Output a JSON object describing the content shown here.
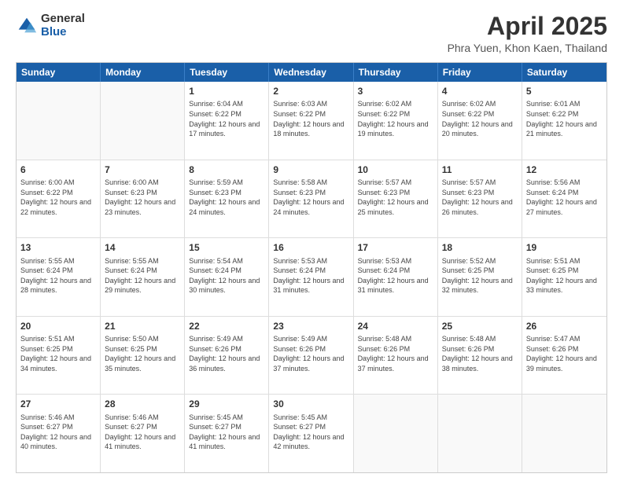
{
  "logo": {
    "general": "General",
    "blue": "Blue"
  },
  "title": {
    "main": "April 2025",
    "sub": "Phra Yuen, Khon Kaen, Thailand"
  },
  "header_days": [
    "Sunday",
    "Monday",
    "Tuesday",
    "Wednesday",
    "Thursday",
    "Friday",
    "Saturday"
  ],
  "rows": [
    [
      {
        "day": "",
        "info": ""
      },
      {
        "day": "",
        "info": ""
      },
      {
        "day": "1",
        "info": "Sunrise: 6:04 AM\nSunset: 6:22 PM\nDaylight: 12 hours and 17 minutes."
      },
      {
        "day": "2",
        "info": "Sunrise: 6:03 AM\nSunset: 6:22 PM\nDaylight: 12 hours and 18 minutes."
      },
      {
        "day": "3",
        "info": "Sunrise: 6:02 AM\nSunset: 6:22 PM\nDaylight: 12 hours and 19 minutes."
      },
      {
        "day": "4",
        "info": "Sunrise: 6:02 AM\nSunset: 6:22 PM\nDaylight: 12 hours and 20 minutes."
      },
      {
        "day": "5",
        "info": "Sunrise: 6:01 AM\nSunset: 6:22 PM\nDaylight: 12 hours and 21 minutes."
      }
    ],
    [
      {
        "day": "6",
        "info": "Sunrise: 6:00 AM\nSunset: 6:22 PM\nDaylight: 12 hours and 22 minutes."
      },
      {
        "day": "7",
        "info": "Sunrise: 6:00 AM\nSunset: 6:23 PM\nDaylight: 12 hours and 23 minutes."
      },
      {
        "day": "8",
        "info": "Sunrise: 5:59 AM\nSunset: 6:23 PM\nDaylight: 12 hours and 24 minutes."
      },
      {
        "day": "9",
        "info": "Sunrise: 5:58 AM\nSunset: 6:23 PM\nDaylight: 12 hours and 24 minutes."
      },
      {
        "day": "10",
        "info": "Sunrise: 5:57 AM\nSunset: 6:23 PM\nDaylight: 12 hours and 25 minutes."
      },
      {
        "day": "11",
        "info": "Sunrise: 5:57 AM\nSunset: 6:23 PM\nDaylight: 12 hours and 26 minutes."
      },
      {
        "day": "12",
        "info": "Sunrise: 5:56 AM\nSunset: 6:24 PM\nDaylight: 12 hours and 27 minutes."
      }
    ],
    [
      {
        "day": "13",
        "info": "Sunrise: 5:55 AM\nSunset: 6:24 PM\nDaylight: 12 hours and 28 minutes."
      },
      {
        "day": "14",
        "info": "Sunrise: 5:55 AM\nSunset: 6:24 PM\nDaylight: 12 hours and 29 minutes."
      },
      {
        "day": "15",
        "info": "Sunrise: 5:54 AM\nSunset: 6:24 PM\nDaylight: 12 hours and 30 minutes."
      },
      {
        "day": "16",
        "info": "Sunrise: 5:53 AM\nSunset: 6:24 PM\nDaylight: 12 hours and 31 minutes."
      },
      {
        "day": "17",
        "info": "Sunrise: 5:53 AM\nSunset: 6:24 PM\nDaylight: 12 hours and 31 minutes."
      },
      {
        "day": "18",
        "info": "Sunrise: 5:52 AM\nSunset: 6:25 PM\nDaylight: 12 hours and 32 minutes."
      },
      {
        "day": "19",
        "info": "Sunrise: 5:51 AM\nSunset: 6:25 PM\nDaylight: 12 hours and 33 minutes."
      }
    ],
    [
      {
        "day": "20",
        "info": "Sunrise: 5:51 AM\nSunset: 6:25 PM\nDaylight: 12 hours and 34 minutes."
      },
      {
        "day": "21",
        "info": "Sunrise: 5:50 AM\nSunset: 6:25 PM\nDaylight: 12 hours and 35 minutes."
      },
      {
        "day": "22",
        "info": "Sunrise: 5:49 AM\nSunset: 6:26 PM\nDaylight: 12 hours and 36 minutes."
      },
      {
        "day": "23",
        "info": "Sunrise: 5:49 AM\nSunset: 6:26 PM\nDaylight: 12 hours and 37 minutes."
      },
      {
        "day": "24",
        "info": "Sunrise: 5:48 AM\nSunset: 6:26 PM\nDaylight: 12 hours and 37 minutes."
      },
      {
        "day": "25",
        "info": "Sunrise: 5:48 AM\nSunset: 6:26 PM\nDaylight: 12 hours and 38 minutes."
      },
      {
        "day": "26",
        "info": "Sunrise: 5:47 AM\nSunset: 6:26 PM\nDaylight: 12 hours and 39 minutes."
      }
    ],
    [
      {
        "day": "27",
        "info": "Sunrise: 5:46 AM\nSunset: 6:27 PM\nDaylight: 12 hours and 40 minutes."
      },
      {
        "day": "28",
        "info": "Sunrise: 5:46 AM\nSunset: 6:27 PM\nDaylight: 12 hours and 41 minutes."
      },
      {
        "day": "29",
        "info": "Sunrise: 5:45 AM\nSunset: 6:27 PM\nDaylight: 12 hours and 41 minutes."
      },
      {
        "day": "30",
        "info": "Sunrise: 5:45 AM\nSunset: 6:27 PM\nDaylight: 12 hours and 42 minutes."
      },
      {
        "day": "",
        "info": ""
      },
      {
        "day": "",
        "info": ""
      },
      {
        "day": "",
        "info": ""
      }
    ]
  ]
}
